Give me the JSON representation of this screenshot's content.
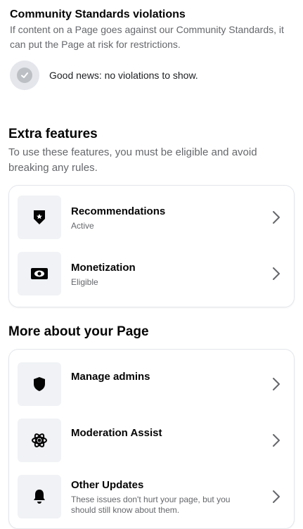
{
  "community": {
    "title": "Community Standards violations",
    "description": "If content on a Page goes against our Community Standards, it can put the Page at risk for restrictions.",
    "status_text": "Good news: no violations to show.",
    "status_icon": "check-icon"
  },
  "extra": {
    "title": "Extra features",
    "description": "To use these features, you must be eligible and avoid breaking any rules.",
    "items": [
      {
        "label": "Recommendations",
        "status": "Active",
        "icon": "shield-star-icon"
      },
      {
        "label": "Monetization",
        "status": "Eligible",
        "icon": "money-icon"
      }
    ]
  },
  "more": {
    "title": "More about your Page",
    "items": [
      {
        "label": "Manage admins",
        "subtitle": "",
        "icon": "shield-icon"
      },
      {
        "label": "Moderation Assist",
        "subtitle": "",
        "icon": "moderation-icon"
      },
      {
        "label": "Other Updates",
        "subtitle": "These issues don't hurt your page, but you should still know about them.",
        "icon": "bell-icon"
      }
    ]
  }
}
